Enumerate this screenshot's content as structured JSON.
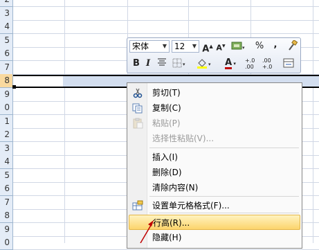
{
  "spreadsheet": {
    "row_numbers": [
      "2",
      "3",
      "4",
      "5",
      "6",
      "7",
      "8",
      "9",
      "0",
      "1",
      "2",
      "3",
      "4",
      "5",
      "6",
      "7",
      "8",
      "9",
      "0"
    ],
    "selected_row": "8"
  },
  "mini_toolbar": {
    "font_name": "宋体",
    "font_size": "12",
    "grow_font": "A",
    "shrink_font": "A",
    "percent": "%",
    "comma": ",",
    "bold": "B",
    "italic": "I",
    "font_color": "A",
    "inc_decimal": "+.0 .00",
    "dec_decimal": ".00 +.0"
  },
  "context_menu": {
    "items": [
      {
        "label": "剪切(T)",
        "icon": "scissors-icon",
        "enabled": true
      },
      {
        "label": "复制(C)",
        "icon": "copy-icon",
        "enabled": true
      },
      {
        "label": "粘贴(P)",
        "icon": "paste-icon",
        "enabled": false
      },
      {
        "label": "选择性粘贴(V)...",
        "icon": "",
        "enabled": false
      },
      {
        "label": "插入(I)",
        "icon": "",
        "enabled": true
      },
      {
        "label": "删除(D)",
        "icon": "",
        "enabled": true
      },
      {
        "label": "清除内容(N)",
        "icon": "",
        "enabled": true
      },
      {
        "label": "设置单元格格式(F)...",
        "icon": "format-cells-icon",
        "enabled": true
      },
      {
        "label": "行高(R)...",
        "icon": "",
        "enabled": true,
        "highlighted": true
      },
      {
        "label": "隐藏(H)",
        "icon": "",
        "enabled": true
      }
    ]
  },
  "colors": {
    "header_bg": "#e4ecf7",
    "selected_header": "#f9d99f",
    "highlight": "#fcd46c",
    "arrow": "#c00000"
  }
}
